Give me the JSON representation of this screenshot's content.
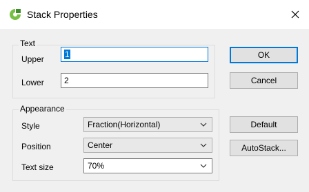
{
  "window": {
    "title": "Stack Properties",
    "app_icon": "cad-app-icon",
    "close_icon": "close-icon"
  },
  "text_group": {
    "legend": "Text",
    "upper_label": "Upper",
    "upper_value": "1",
    "lower_label": "Lower",
    "lower_value": "2"
  },
  "appearance_group": {
    "legend": "Appearance",
    "style_label": "Style",
    "style_value": "Fraction(Horizontal)",
    "position_label": "Position",
    "position_value": "Center",
    "text_size_label": "Text size",
    "text_size_value": "70%"
  },
  "buttons": {
    "ok": "OK",
    "cancel": "Cancel",
    "default": "Default",
    "autostack": "AutoStack..."
  },
  "colors": {
    "accent": "#0078d7",
    "icon_green": "#78c043"
  }
}
